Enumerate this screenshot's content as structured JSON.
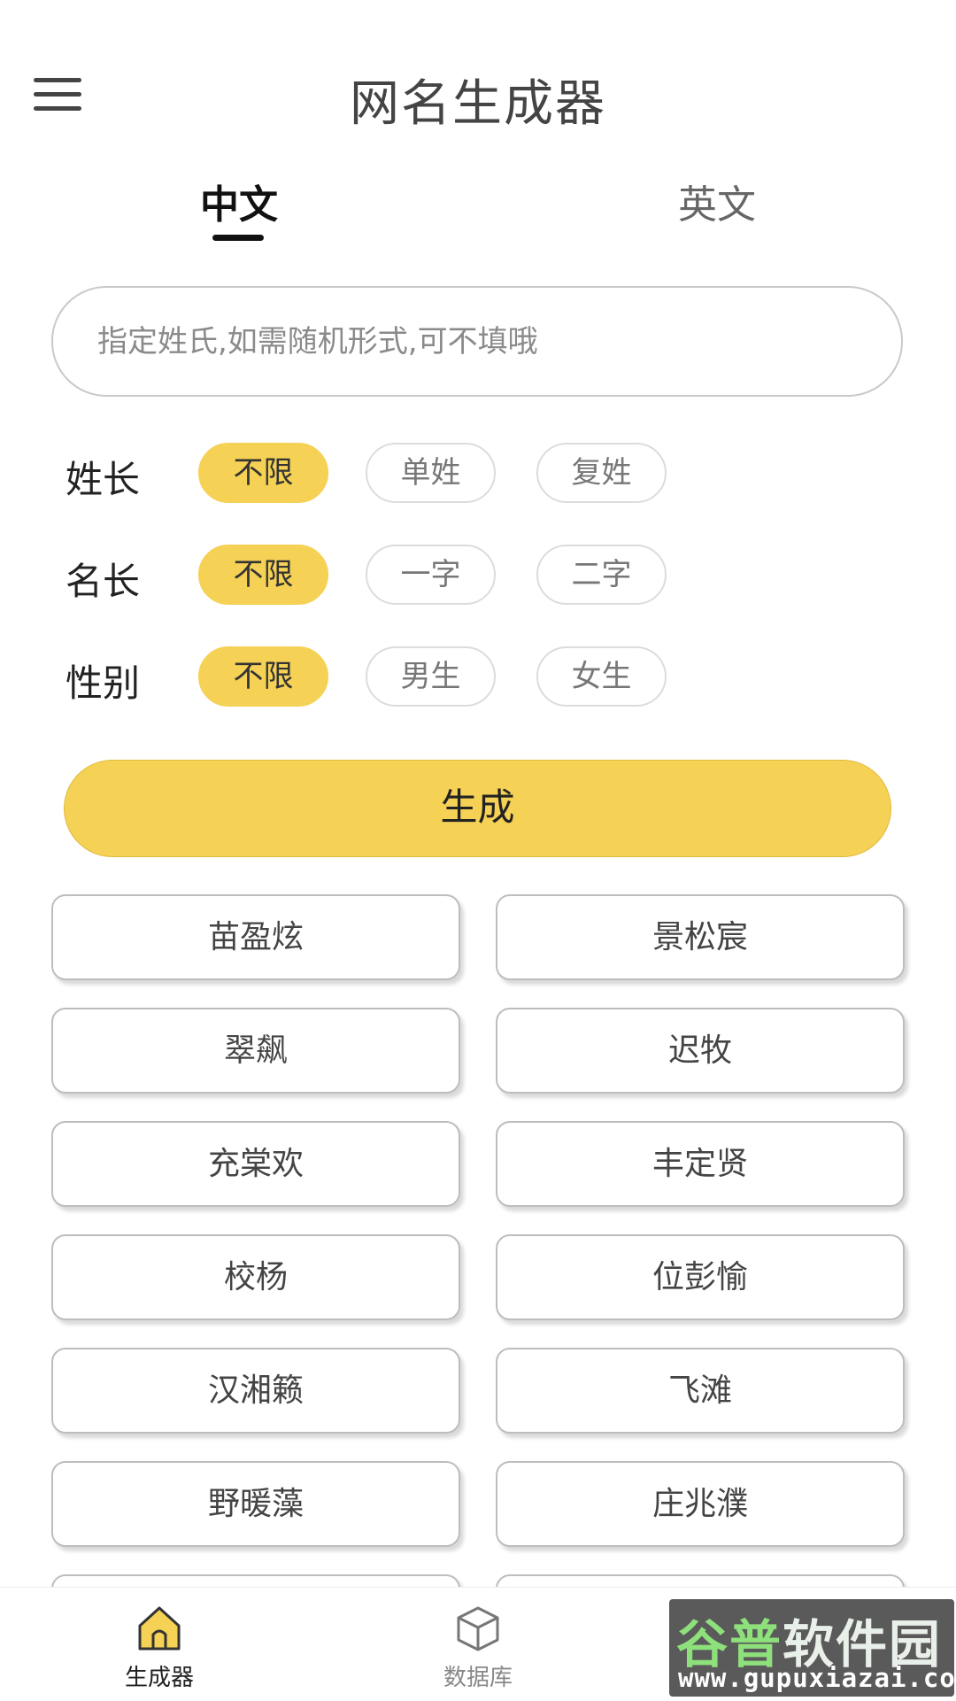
{
  "header": {
    "title": "网名生成器",
    "menu_icon": "hamburger-menu-icon"
  },
  "tabs": [
    {
      "label": "中文",
      "active": true
    },
    {
      "label": "英文",
      "active": false
    }
  ],
  "search": {
    "placeholder": "指定姓氏,如需随机形式,可不填哦",
    "value": ""
  },
  "filters": [
    {
      "label": "姓长",
      "options": [
        "不限",
        "单姓",
        "复姓"
      ],
      "selected": "不限"
    },
    {
      "label": "名长",
      "options": [
        "不限",
        "一字",
        "二字"
      ],
      "selected": "不限"
    },
    {
      "label": "性别",
      "options": [
        "不限",
        "男生",
        "女生"
      ],
      "selected": "不限"
    }
  ],
  "generate_button": "生成",
  "names": [
    "苗盈炫",
    "景松宸",
    "翠飙",
    "迟牧",
    "充棠欢",
    "丰定贤",
    "校杨",
    "位彭愉",
    "汉湘籁",
    "飞滩",
    "野暖藻",
    "庄兆濮"
  ],
  "bottom_nav": [
    {
      "label": "生成器",
      "icon": "home-icon",
      "active": true
    },
    {
      "label": "数据库",
      "icon": "cube-icon",
      "active": false
    }
  ],
  "watermark": {
    "line1": "谷普软件园",
    "line2": "www.gupuxiazai.com"
  },
  "colors": {
    "accent": "#f5d155",
    "text": "#333333",
    "muted": "#777777"
  }
}
